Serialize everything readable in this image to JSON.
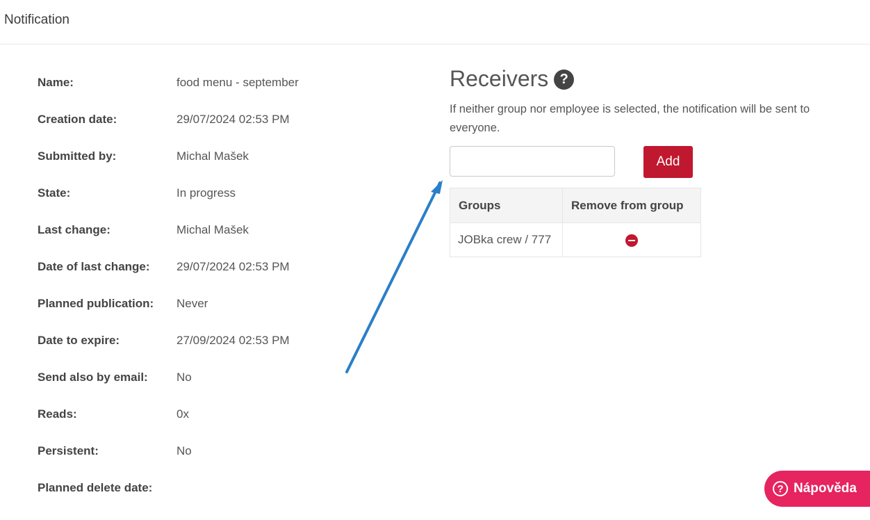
{
  "header": {
    "title": "Notification"
  },
  "details": [
    {
      "label": "Name:",
      "value": "food menu - september"
    },
    {
      "label": "Creation date:",
      "value": "29/07/2024 02:53 PM"
    },
    {
      "label": "Submitted by:",
      "value": "Michal Mašek"
    },
    {
      "label": "State:",
      "value": "In progress"
    },
    {
      "label": "Last change:",
      "value": "Michal Mašek"
    },
    {
      "label": "Date of last change:",
      "value": "29/07/2024 02:53 PM"
    },
    {
      "label": "Planned publication:",
      "value": "Never"
    },
    {
      "label": "Date to expire:",
      "value": "27/09/2024 02:53 PM"
    },
    {
      "label": "Send also by email:",
      "value": "No"
    },
    {
      "label": "Reads:",
      "value": "0x"
    },
    {
      "label": "Persistent:",
      "value": "No"
    },
    {
      "label": "Planned delete date:",
      "value": ""
    }
  ],
  "receivers": {
    "title": "Receivers",
    "help_icon": "?",
    "note": "If neither group nor employee is selected, the notification will be sent to everyone.",
    "search_value": "",
    "add_label": "Add",
    "table": {
      "headers": [
        "Groups",
        "Remove from group"
      ],
      "rows": [
        {
          "group": "JOBka crew / 777",
          "remove_icon": "remove-circle-icon"
        }
      ]
    }
  },
  "help_button": {
    "icon": "?",
    "label": "Nápověda"
  },
  "colors": {
    "accent": "#c0182f",
    "help_button": "#e6245f",
    "annotation_arrow": "#2a7fc9"
  }
}
